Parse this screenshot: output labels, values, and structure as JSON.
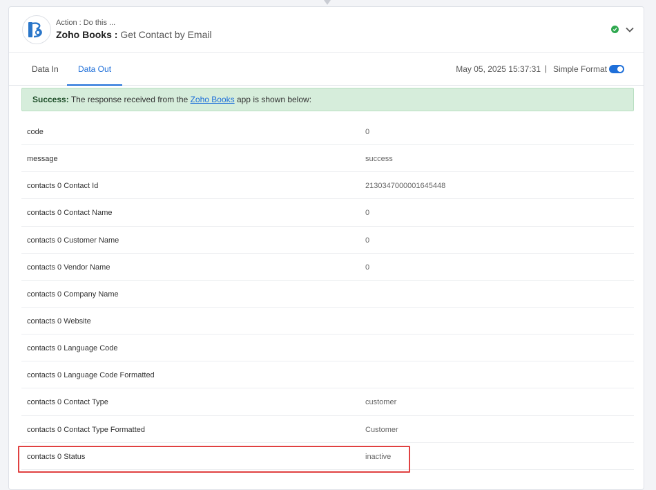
{
  "header": {
    "subtitle": "Action : Do this ...",
    "app_name": "Zoho Books :",
    "action_name": "Get Contact by Email",
    "status_icon": "check-circle-icon",
    "accent_green": "#2fa84f"
  },
  "tabs": [
    {
      "label": "Data In"
    },
    {
      "label": "Data Out"
    }
  ],
  "toolbar": {
    "timestamp": "May 05, 2025 15:37:31",
    "separator": "|",
    "format_label": "Simple Format"
  },
  "banner": {
    "strong": "Success:",
    "text_before": " The response received from the ",
    "link": "Zoho Books",
    "text_after": " app is shown below:"
  },
  "rows": [
    {
      "key": "code",
      "value": "0"
    },
    {
      "key": "message",
      "value": "success"
    },
    {
      "key": "contacts 0 Contact Id",
      "value": "2130347000001645448"
    },
    {
      "key": "contacts 0 Contact Name",
      "value": "0"
    },
    {
      "key": "contacts 0 Customer Name",
      "value": "0"
    },
    {
      "key": "contacts 0 Vendor Name",
      "value": "0"
    },
    {
      "key": "contacts 0 Company Name",
      "value": ""
    },
    {
      "key": "contacts 0 Website",
      "value": ""
    },
    {
      "key": "contacts 0 Language Code",
      "value": ""
    },
    {
      "key": "contacts 0 Language Code Formatted",
      "value": ""
    },
    {
      "key": "contacts 0 Contact Type",
      "value": "customer"
    },
    {
      "key": "contacts 0 Contact Type Formatted",
      "value": "Customer"
    },
    {
      "key": "contacts 0 Status",
      "value": "inactive"
    }
  ]
}
